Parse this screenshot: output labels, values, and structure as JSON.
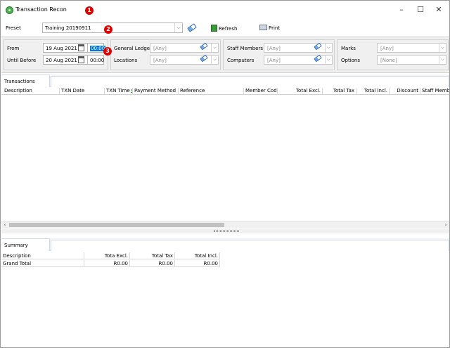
{
  "window": {
    "title": "Transaction Recon",
    "controls": {
      "minimize": "–",
      "maximize": "☐",
      "close": "✕"
    }
  },
  "badges": [
    "1",
    "2",
    "3"
  ],
  "toolbar": {
    "preset_label": "Preset",
    "preset_value": "Training 20190911",
    "refresh_label": "Refresh",
    "print_label": "Print"
  },
  "filters": {
    "from_label": "From",
    "from_date": "19 Aug 2021",
    "from_time": "00:00",
    "until_label": "Until Before",
    "until_date": "20 Aug 2021",
    "until_time": "00:00",
    "general_ledgers_label": "General Ledgers",
    "general_ledgers_value": "[Any]",
    "locations_label": "Locations",
    "locations_value": "[Any]",
    "staff_members_label": "Staff Members",
    "staff_members_value": "[Any]",
    "computers_label": "Computers",
    "computers_value": "[Any]",
    "marks_label": "Marks",
    "marks_value": "[Any]",
    "options_label": "Options",
    "options_value": "[None]"
  },
  "transactions": {
    "tab_label": "Transactions",
    "columns": [
      "Description",
      "TXN Date",
      "TXN Time",
      "Payment Method",
      "Reference",
      "Member Code",
      "Total Excl.",
      "Total Tax",
      "Total Incl.",
      "Discount",
      "Staff Membe"
    ],
    "rows": []
  },
  "summary": {
    "tab_label": "Summary",
    "columns": [
      "Description",
      "Tota Excl.",
      "Total Tax",
      "Total Incl."
    ],
    "rows": [
      [
        "Grand Total",
        "R0.00",
        "R0.00",
        "R0.00"
      ]
    ]
  },
  "icons": [
    "app-icon",
    "eraser-icon",
    "refresh-icon",
    "print-icon",
    "calendar-icon",
    "sort-icon"
  ],
  "colors": {
    "badge": "#e00000",
    "selection": "#0078d7",
    "app_icon": "#4caf50"
  }
}
